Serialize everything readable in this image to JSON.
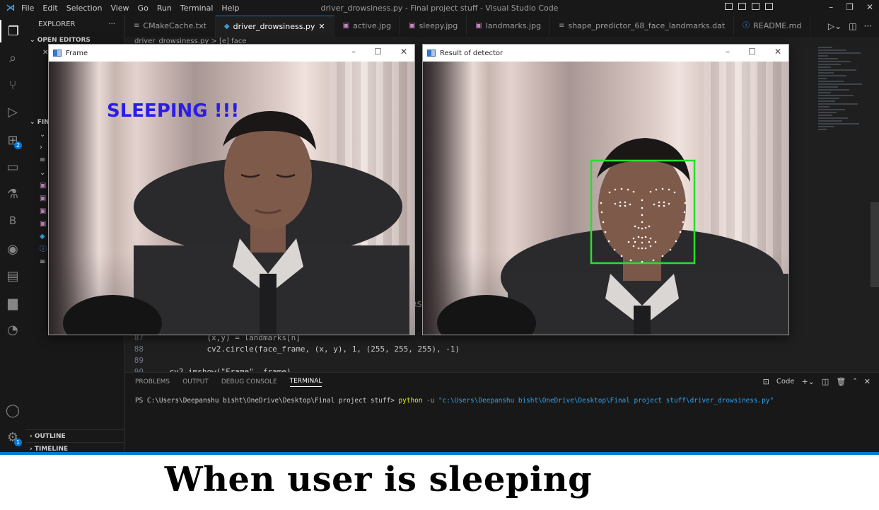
{
  "window_title": "driver_drowsiness.py - Final project stuff - Visual Studio Code",
  "menu": [
    "File",
    "Edit",
    "Selection",
    "View",
    "Go",
    "Run",
    "Terminal",
    "Help"
  ],
  "sidebar": {
    "title": "EXPLORER",
    "open_editors": "OPEN EDITORS",
    "folder_section": "FIN",
    "outline": "OUTLINE",
    "timeline": "TIMELINE"
  },
  "activity": {
    "extensions_badge": "2",
    "settings_badge": "1"
  },
  "tabs": [
    {
      "label": "CMakeCache.txt",
      "icon": "txt"
    },
    {
      "label": "driver_drowsiness.py",
      "icon": "python",
      "active": true
    },
    {
      "label": "active.jpg",
      "icon": "image"
    },
    {
      "label": "sleepy.jpg",
      "icon": "image"
    },
    {
      "label": "landmarks.jpg",
      "icon": "image"
    },
    {
      "label": "shape_predictor_68_face_landmarks.dat",
      "icon": "txt"
    },
    {
      "label": "README.md",
      "icon": "info"
    }
  ],
  "breadcrumb": "driver_drowsiness.py > [e] face",
  "code": {
    "lines": [
      {
        "num": "87",
        "text": "            (x,y) = landmarks[n]"
      },
      {
        "num": "88",
        "text": "            cv2.circle(face_frame, (x, y), 1, (255, 255, 255), -1)"
      },
      {
        "num": "89",
        "text": ""
      },
      {
        "num": "90",
        "text": "    cv2.imshow(\"Frame\", frame)"
      }
    ],
    "partial_fragment": "RS"
  },
  "panel": {
    "tabs": [
      "PROBLEMS",
      "OUTPUT",
      "DEBUG CONSOLE",
      "TERMINAL"
    ],
    "active_tab": "TERMINAL",
    "terminal_kind": "Code",
    "prompt": "PS C:\\Users\\Deepanshu bisht\\OneDrive\\Desktop\\Final project stuff> ",
    "command": "python",
    "flag": " -u ",
    "script_path": "\"c:\\Users\\Deepanshu bisht\\OneDrive\\Desktop\\Final project stuff\\driver_drowsiness.py\""
  },
  "frame_window": {
    "title": "Frame",
    "status_text": "SLEEPING !!!",
    "status_color": "#2a1ee6"
  },
  "detector_window": {
    "title": "Result of detector",
    "box_color": "#22e22a"
  },
  "caption": "When user is sleeping"
}
